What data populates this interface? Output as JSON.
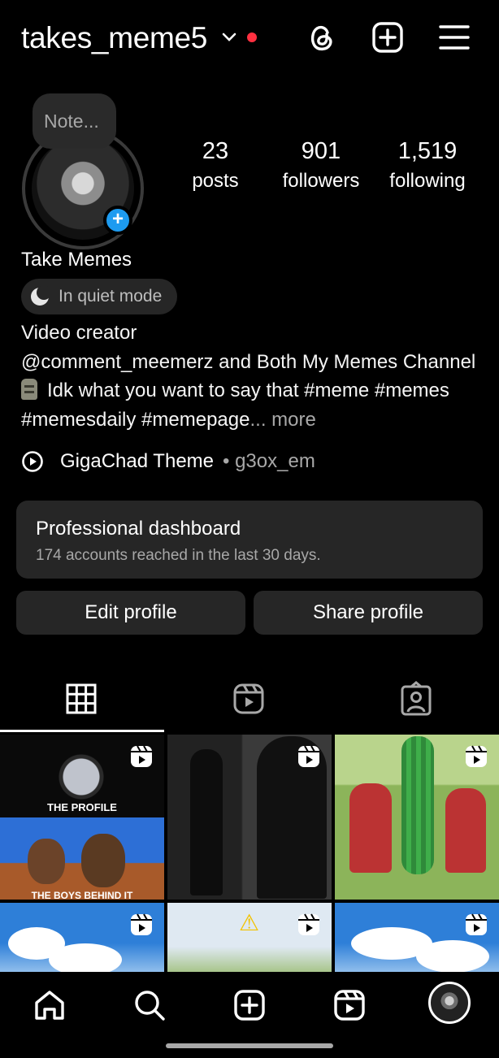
{
  "header": {
    "username": "takes_meme5",
    "icons": [
      "threads-icon",
      "create-icon",
      "menu-icon"
    ],
    "notification_color": "#ff3040"
  },
  "profile": {
    "note_placeholder": "Note...",
    "stats": [
      {
        "value": "23",
        "label": "posts"
      },
      {
        "value": "901",
        "label": "followers"
      },
      {
        "value": "1,519",
        "label": "following"
      }
    ],
    "full_name": "Take Memes",
    "quiet_mode": "In quiet mode",
    "bio": {
      "line1": "Video creator",
      "line2": "@comment_meemerz and Both My Memes Channel",
      "line3": "Idk what you want to say that #meme #memes",
      "line4": "#memesdaily #memepage",
      "more": "... more"
    },
    "music": {
      "title": "GigaChad Theme",
      "separator": " • ",
      "artist": "g3ox_em"
    }
  },
  "dashboard": {
    "title": "Professional dashboard",
    "subtitle": "174 accounts reached in the last 30 days."
  },
  "actions": {
    "edit": "Edit profile",
    "share": "Share profile"
  },
  "tabs": [
    "grid-icon",
    "reels-icon",
    "tagged-icon"
  ],
  "grid": {
    "cell1_caption_top": "THE PROFILE",
    "cell1_caption_bottom": "THE BOYS BEHIND IT"
  },
  "navbar": [
    "home-icon",
    "search-icon",
    "create-icon",
    "reels-icon",
    "profile-avatar"
  ],
  "colors": {
    "accent": "#1d9bf0",
    "surface": "#262626",
    "muted": "#a8a8a8"
  }
}
